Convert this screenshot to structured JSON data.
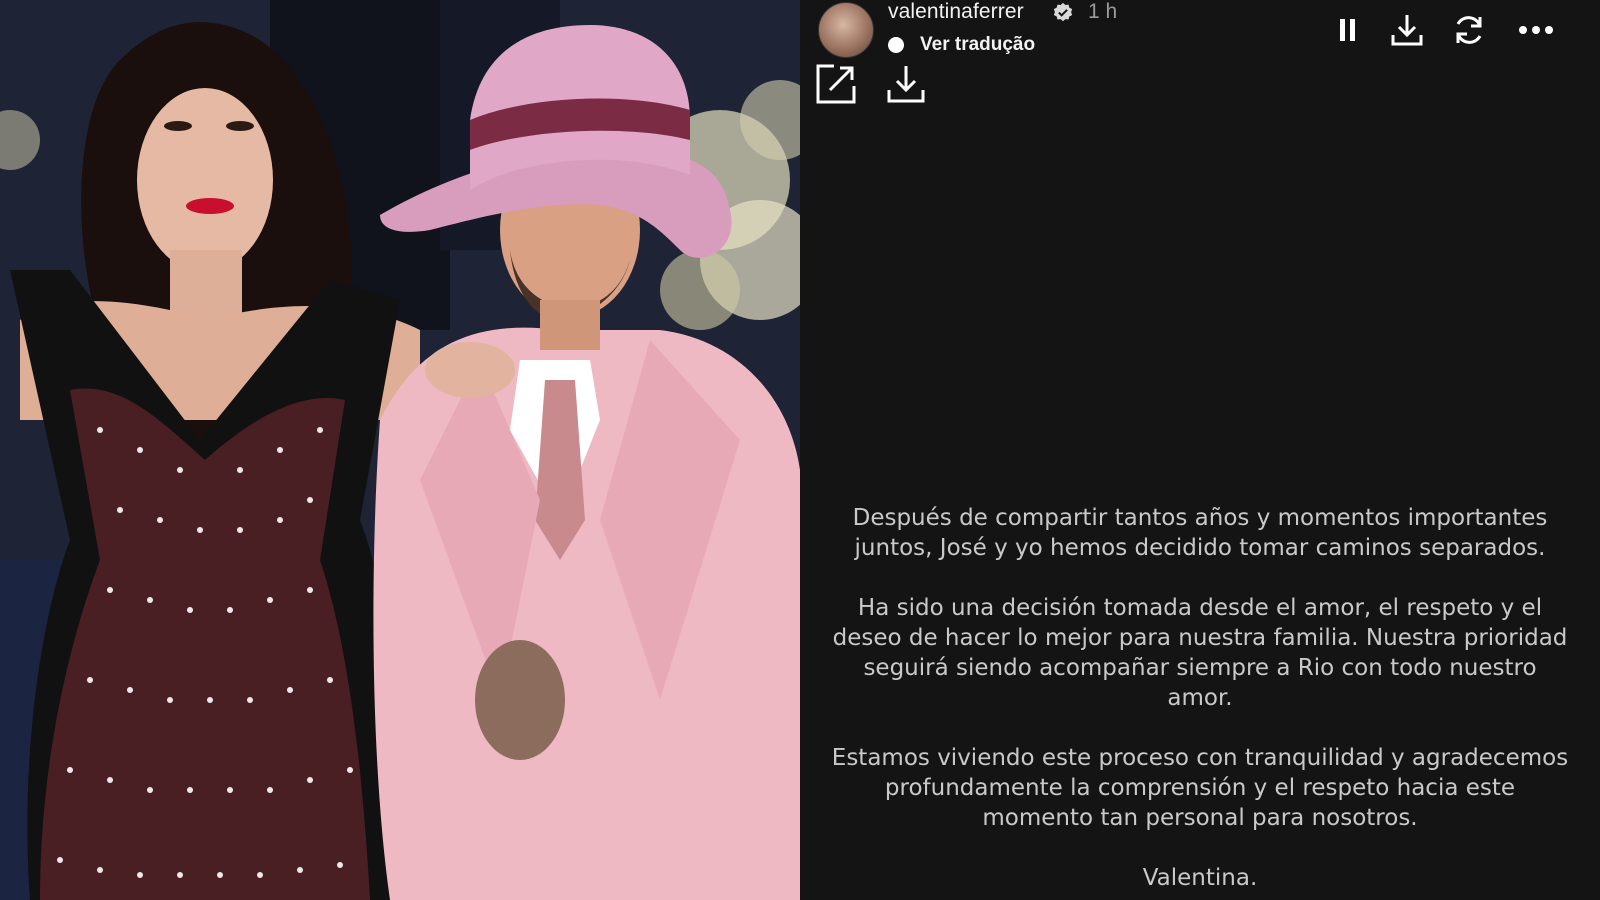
{
  "story": {
    "username": "valentinaferrer",
    "time": "1 h",
    "translate_label": "Ver tradução",
    "controls": [
      "pause-icon",
      "download-icon",
      "refresh-icon",
      "more-icon"
    ],
    "secondary_controls": [
      "open-external-icon",
      "download-icon"
    ],
    "message": {
      "p1": "Después de compartir tantos años y momentos importantes juntos, José y yo hemos decidido tomar caminos separados.",
      "p2": "Ha sido una decisión tomada desde el amor, el respeto y el deseo de hacer lo mejor para nuestra familia. Nuestra prioridad seguirá siendo acompañar siempre a Rio con todo nuestro amor.",
      "p3": "Estamos viviendo este proceso con tranquilidad y agradecemos profundamente la comprensión y el respeto hacia este momento tan personal para nosotros.",
      "signature": "Valentina."
    }
  },
  "colors": {
    "story_bg": "#141414",
    "message_text": "#c9c9c9",
    "hat": "#d89cbd",
    "suit": "#efb9c4",
    "dress": "#4a1f24"
  }
}
